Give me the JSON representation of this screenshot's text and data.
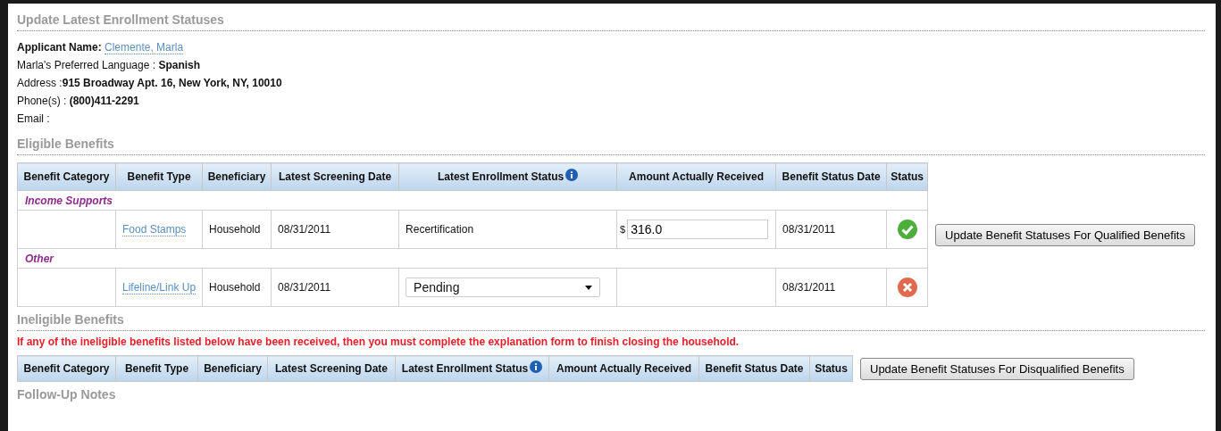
{
  "title": "Update Latest Enrollment Statuses",
  "applicant": {
    "name_label": "Applicant Name:",
    "name": "Clemente, Marla",
    "language_label": "Marla's Preferred Language :",
    "language": "Spanish",
    "address_label": "Address :",
    "address": "915 Broadway Apt. 16, New York, NY, 10010",
    "phone_label": "Phone(s) :",
    "phone": "(800)411-2291",
    "email_label": "Email :"
  },
  "eligible": {
    "heading": "Eligible Benefits",
    "columns": [
      {
        "label": "Benefit Category",
        "info": false
      },
      {
        "label": "Benefit Type",
        "info": false
      },
      {
        "label": "Beneficiary",
        "info": false
      },
      {
        "label": "Latest Screening Date",
        "info": false
      },
      {
        "label": "Latest Enrollment Status",
        "info": true
      },
      {
        "label": "Amount Actually Received",
        "info": false
      },
      {
        "label": "Benefit Status Date",
        "info": false
      },
      {
        "label": "Status",
        "info": false
      }
    ],
    "rows": [
      {
        "kind": "group",
        "label": "Income Supports"
      },
      {
        "kind": "benefit",
        "type": "Food Stamps",
        "beneficiary": "Household",
        "screening_date": "08/31/2011",
        "enrollment": {
          "kind": "text",
          "value": "Recertification"
        },
        "amount": {
          "currency": "$",
          "value": "316.0"
        },
        "status_date": "08/31/2011",
        "approved": true
      },
      {
        "kind": "group",
        "label": "Other"
      },
      {
        "kind": "benefit",
        "type": "Lifeline/Link Up",
        "beneficiary": "Household",
        "screening_date": "08/31/2011",
        "enrollment": {
          "kind": "select",
          "value": "Pending"
        },
        "status_date": "08/31/2011",
        "approved": false
      }
    ],
    "button": "Update Benefit Statuses For Qualified Benefits"
  },
  "ineligible": {
    "heading": "Ineligible Benefits",
    "warning": "If any of the ineligible benefits listed below have been received, then you must complete the explanation form to finish closing the household.",
    "columns": [
      {
        "label": "Benefit Category",
        "info": false
      },
      {
        "label": "Benefit Type",
        "info": false
      },
      {
        "label": "Beneficiary",
        "info": false
      },
      {
        "label": "Latest Screening Date",
        "info": false
      },
      {
        "label": "Latest Enrollment Status",
        "info": true
      },
      {
        "label": "Amount Actually Received",
        "info": false
      },
      {
        "label": "Benefit Status Date",
        "info": false
      },
      {
        "label": "Status",
        "info": false
      }
    ],
    "button": "Update Benefit Statuses For Disqualified Benefits"
  },
  "followup": {
    "heading": "Follow-Up Notes"
  }
}
